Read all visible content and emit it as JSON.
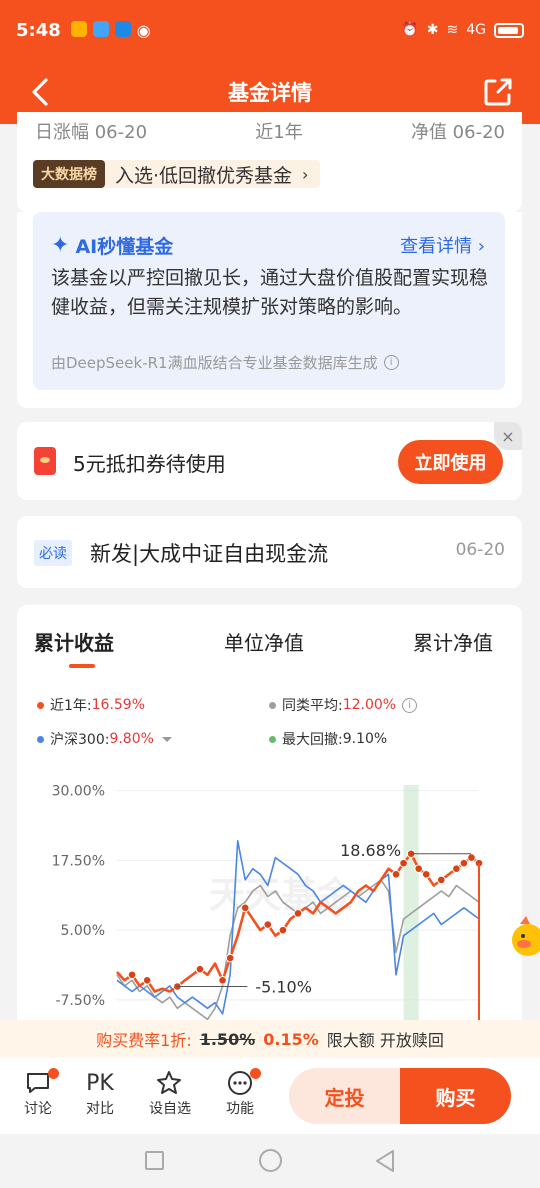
{
  "status_bar": {
    "time": "5:48",
    "network": "4G"
  },
  "nav": {
    "title": "基金详情"
  },
  "stats_cut": {
    "col1": "日涨幅 06-20",
    "col2": "近1年",
    "col3": "净值 06-20"
  },
  "big_data": {
    "badge": "大数据榜",
    "text": "入选·低回撤优秀基金"
  },
  "ai": {
    "title": "AI秒懂基金",
    "more": "查看详情",
    "body": "该基金以严控回撤见长，通过大盘价值股配置实现稳健收益，但需关注规模扩张对策略的影响。",
    "footer": "由DeepSeek-R1满血版结合专业基金数据库生成"
  },
  "coupon": {
    "text": "5元抵扣券待使用",
    "button": "立即使用"
  },
  "news": {
    "badge": "必读",
    "title": "新发|大成中证自由现金流",
    "date": "06-20"
  },
  "tabs": [
    "累计收益",
    "单位净值",
    "累计净值"
  ],
  "legend": {
    "l1_label": "近1年:",
    "l1_value": "16.59%",
    "l2_label": "同类平均:",
    "l2_value": "12.00%",
    "l3_label": "沪深300:",
    "l3_value": "9.80%",
    "l4_label": "最大回撤:",
    "l4_value": "9.10%"
  },
  "colors": {
    "fund": "#f4511e",
    "peer": "#9e9e9e",
    "hs300": "#4a86e8",
    "drawdown": "#66bb6a"
  },
  "chart_data": {
    "type": "line",
    "y_tick_labels": [
      "30.00%",
      "17.50%",
      "5.00%",
      "-7.50%"
    ],
    "ylim": [
      -12,
      31
    ],
    "x": [
      0,
      1,
      2,
      3,
      4,
      5,
      6,
      7,
      8,
      9,
      10,
      11,
      12,
      13,
      14,
      15,
      16,
      17,
      18,
      19,
      20,
      21,
      22,
      23,
      24,
      25,
      26,
      27,
      28,
      29,
      30,
      31,
      32,
      33,
      34,
      35,
      36,
      37,
      38,
      39,
      40,
      41,
      42,
      43,
      44,
      45,
      46,
      47,
      48
    ],
    "series": [
      {
        "name": "近1年",
        "values": [
          -2.5,
          -4,
          -3,
          -5,
          -4,
          -6,
          -5.5,
          -6,
          -5.1,
          -4,
          -3,
          -2,
          -3,
          -1,
          -4,
          0,
          4,
          9,
          7,
          5,
          6,
          4,
          5,
          7,
          8,
          9,
          8,
          10,
          9,
          8,
          9,
          10,
          12,
          13,
          12,
          14,
          16,
          15,
          17,
          18.68,
          16,
          15,
          13,
          14,
          15,
          16,
          17,
          18,
          17
        ]
      },
      {
        "name": "同类平均",
        "values": [
          -3,
          -5,
          -4,
          -6,
          -5,
          -7,
          -8,
          -7,
          -9,
          -8,
          -9,
          -10,
          -11,
          -9,
          -5,
          4,
          9,
          10,
          12,
          13,
          11,
          12,
          10,
          9,
          8,
          9,
          10,
          8,
          9,
          10,
          11,
          12,
          11,
          12,
          13,
          14,
          12,
          1,
          7,
          8,
          9,
          10,
          11,
          12,
          11,
          13,
          12,
          11,
          10
        ]
      },
      {
        "name": "沪深300",
        "values": [
          -4,
          -5,
          -6,
          -5,
          -6,
          -7,
          -6,
          -5,
          -7,
          -8,
          -7,
          -8,
          -9,
          -8,
          -10,
          -3,
          21,
          14,
          16,
          15,
          13,
          18,
          17,
          16,
          15,
          13,
          12,
          10,
          11,
          12,
          13,
          12,
          11,
          10,
          12,
          14,
          15,
          -3,
          4,
          5,
          6,
          7,
          8,
          6,
          7,
          8,
          9,
          8,
          7
        ]
      }
    ],
    "annotations": [
      "18.68%",
      "-5.10%"
    ],
    "watermark": "天天基金"
  },
  "fee": {
    "prefix": "购买费率1折:",
    "original": "1.50%",
    "discount": "0.15%",
    "note": "限大额 开放赎回"
  },
  "actions": {
    "discuss": "讨论",
    "compare_icon": "PK",
    "compare": "对比",
    "watch": "设自选",
    "more": "功能",
    "dingtou": "定投",
    "buy": "购买"
  }
}
